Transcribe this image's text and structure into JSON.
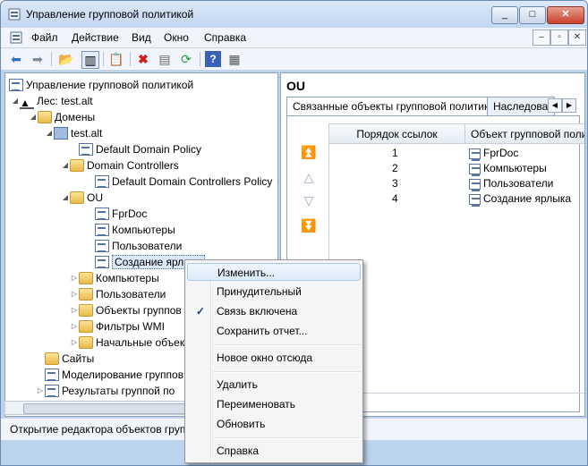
{
  "window": {
    "title": "Управление групповой политикой"
  },
  "menubar": {
    "items": [
      "Файл",
      "Действие",
      "Вид",
      "Окно",
      "Справка"
    ]
  },
  "tree": {
    "root": "Управление групповой политикой",
    "forest": "Лес: test.alt",
    "domains": "Домены",
    "domain": "test.alt",
    "ddp": "Default Domain Policy",
    "dc": "Domain Controllers",
    "ddcp": "Default Domain Controllers Policy",
    "ou": "OU",
    "fprdoc": "FprDoc",
    "computers_gpo": "Компьютеры",
    "users_gpo": "Пользователи",
    "shortcut_gpo": "Создание ярлыка",
    "computers": "Компьютеры",
    "users": "Пользователи",
    "gpo_objects": "Объекты группов",
    "wmi": "Фильтры WMI",
    "starter": "Начальные объек",
    "sites": "Сайты",
    "modeling": "Моделирование группов",
    "results": "Результаты группой по"
  },
  "right": {
    "title": "OU",
    "tab_linked": "Связанные объекты групповой политики",
    "tab_inherit": "Наследован",
    "col_order": "Порядок ссылок",
    "col_gpo": "Объект групповой поли",
    "rows": [
      {
        "order": "1",
        "gpo": "FprDoc"
      },
      {
        "order": "2",
        "gpo": "Компьютеры"
      },
      {
        "order": "3",
        "gpo": "Пользователи"
      },
      {
        "order": "4",
        "gpo": "Создание ярлыка"
      }
    ]
  },
  "status": {
    "text": "Открытие редактора объектов групп"
  },
  "context_menu": {
    "edit": "Изменить...",
    "enforced": "Принудительный",
    "link_enabled": "Связь включена",
    "save_report": "Сохранить отчет...",
    "new_window": "Новое окно отсюда",
    "delete": "Удалить",
    "rename": "Переименовать",
    "refresh": "Обновить",
    "help": "Справка"
  },
  "colors": {
    "titlebar": "#c2d7f1",
    "accent": "#1f3f8a",
    "close": "#c7402c"
  }
}
